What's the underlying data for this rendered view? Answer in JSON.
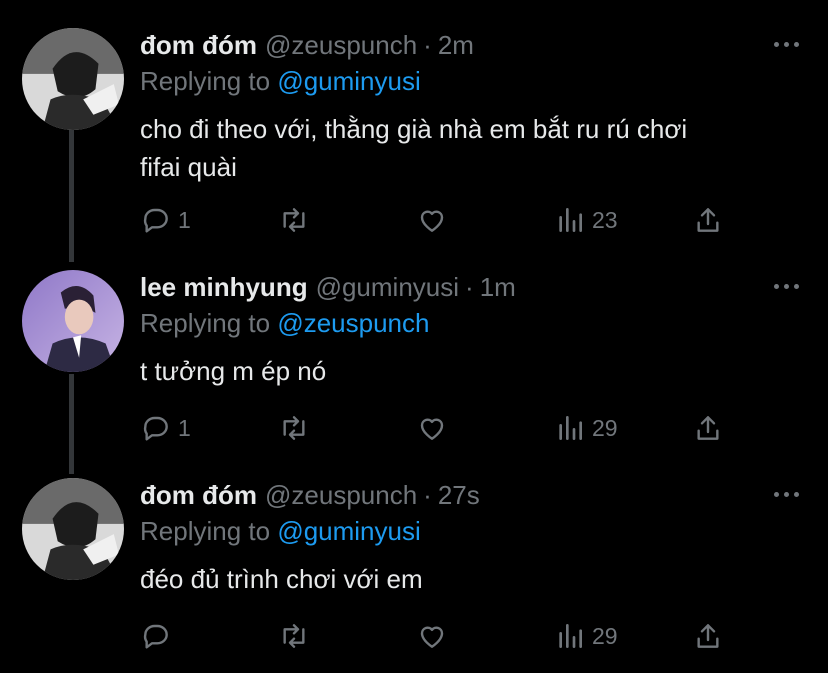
{
  "tweets": [
    {
      "name": "đom đóm",
      "handle": "@zeuspunch",
      "separator": "·",
      "time": "2m",
      "replying_prefix": "Replying to",
      "replying_to": "@guminyusi",
      "text_lines": [
        "cho đi theo với, thằng già nhà em bắt ru rú chơi",
        "fifai quài"
      ],
      "reply_count": "1",
      "retweet_count": "",
      "like_count": "",
      "view_count": "23"
    },
    {
      "name": "lee minhyung",
      "handle": "@guminyusi",
      "separator": "·",
      "time": "1m",
      "replying_prefix": "Replying to",
      "replying_to": "@zeuspunch",
      "text_lines": [
        "t tưởng m ép nó"
      ],
      "reply_count": "1",
      "retweet_count": "",
      "like_count": "",
      "view_count": "29"
    },
    {
      "name": "đom đóm",
      "handle": "@zeuspunch",
      "separator": "·",
      "time": "27s",
      "replying_prefix": "Replying to",
      "replying_to": "@guminyusi",
      "text_lines": [
        "đéo đủ trình chơi với em"
      ],
      "reply_count": "",
      "retweet_count": "",
      "like_count": "",
      "view_count": "29"
    }
  ],
  "colors": {
    "background": "#000000",
    "primary_text": "#e7e9ea",
    "secondary_text": "#71767b",
    "accent": "#1d9bf0",
    "thread_line": "#333639"
  },
  "icons": {
    "reply": "reply-icon",
    "retweet": "retweet-icon",
    "like": "like-icon",
    "views": "views-icon",
    "share": "share-icon",
    "more": "more-icon"
  }
}
